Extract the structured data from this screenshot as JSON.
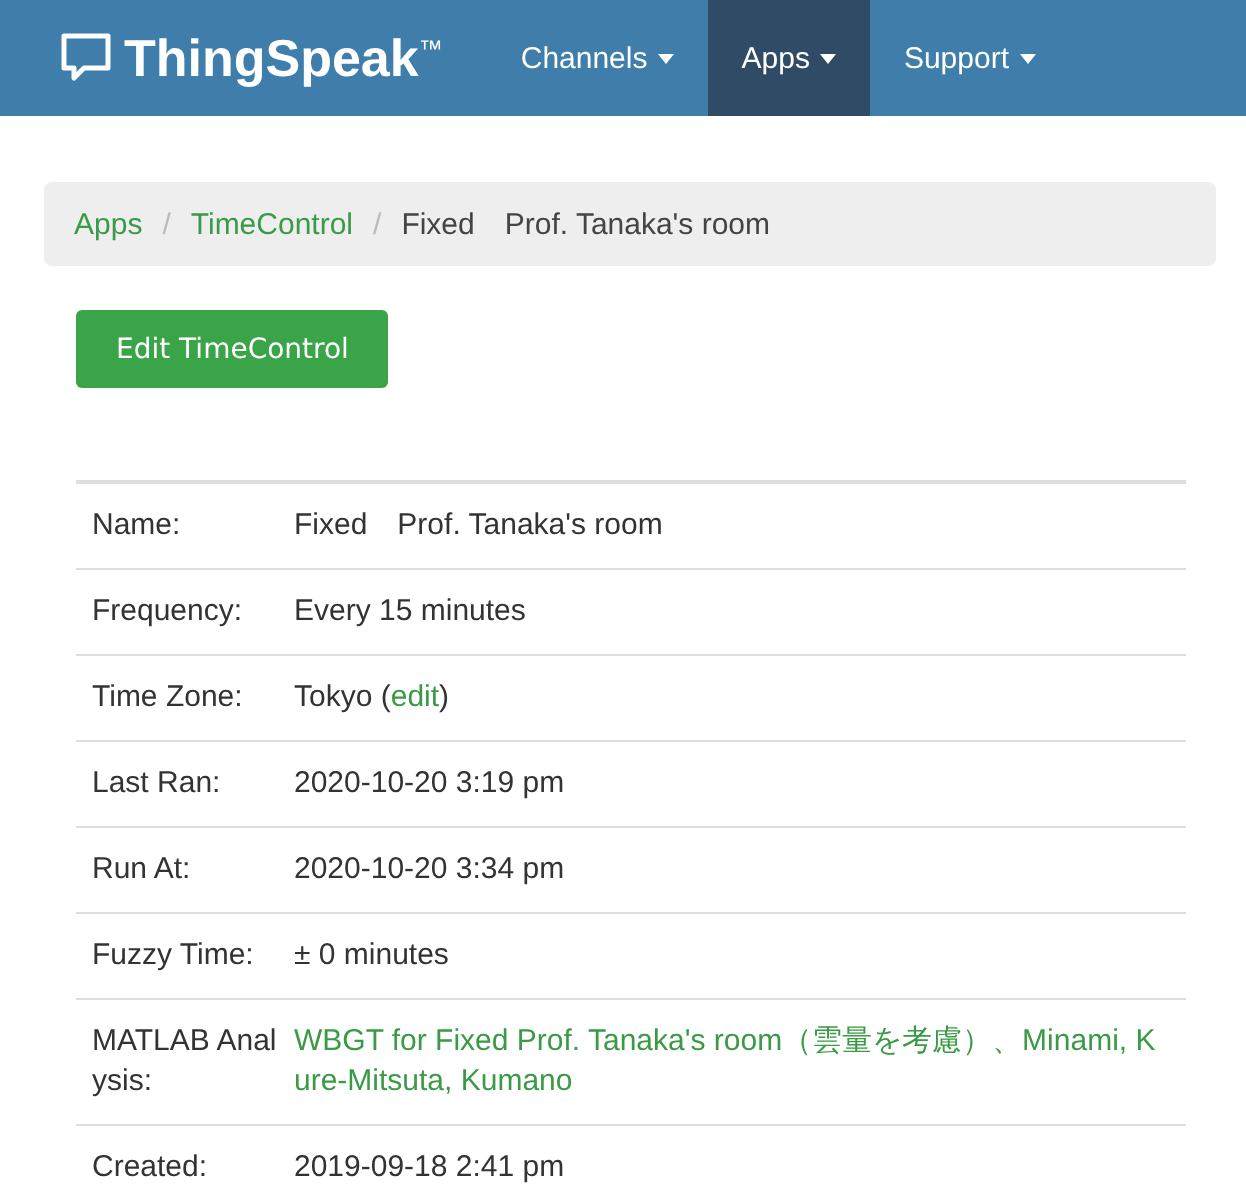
{
  "navbar": {
    "brand": "ThingSpeak$^{™}$",
    "items": [
      {
        "label": "Channels",
        "selected": false
      },
      {
        "label": "Apps",
        "selected": true
      },
      {
        "label": "Support",
        "selected": false
      }
    ]
  },
  "breadcrumb_separator": "/",
  "breadcrumb": [
    {
      "label": "Apps",
      "kind": "link"
    },
    {
      "label": "TimeControl",
      "kind": "link"
    },
    {
      "label": "Fixed　Prof. Tanaka's room",
      "kind": "current"
    }
  ],
  "edit_button": "Edit TimeControl",
  "details": [
    {
      "label": "Name:",
      "kind": "text",
      "value": "Fixed　Prof. Tanaka's room"
    },
    {
      "label": "Frequency:",
      "kind": "text",
      "value": "Every 15 minutes"
    },
    {
      "label": "Time Zone:",
      "kind": "text_with_link",
      "value": "Tokyo (",
      "link": "edit",
      "after": ")"
    },
    {
      "label": "Last Ran:",
      "kind": "text",
      "value": "2020-10-20 3:19 pm"
    },
    {
      "label": "Run At:",
      "kind": "text",
      "value": "2020-10-20 3:34 pm"
    },
    {
      "label": "Fuzzy Time:",
      "kind": "text",
      "value": "± 0 minutes"
    },
    {
      "label": "MATLAB Analysis:",
      "kind": "link",
      "value": "WBGT for Fixed Prof. Tanaka's room（雲量を考慮）、Minami, Kure-Mitsuta, Kumano"
    },
    {
      "label": "Created:",
      "kind": "text",
      "value": "2019-09-18 2:41 pm"
    }
  ]
}
